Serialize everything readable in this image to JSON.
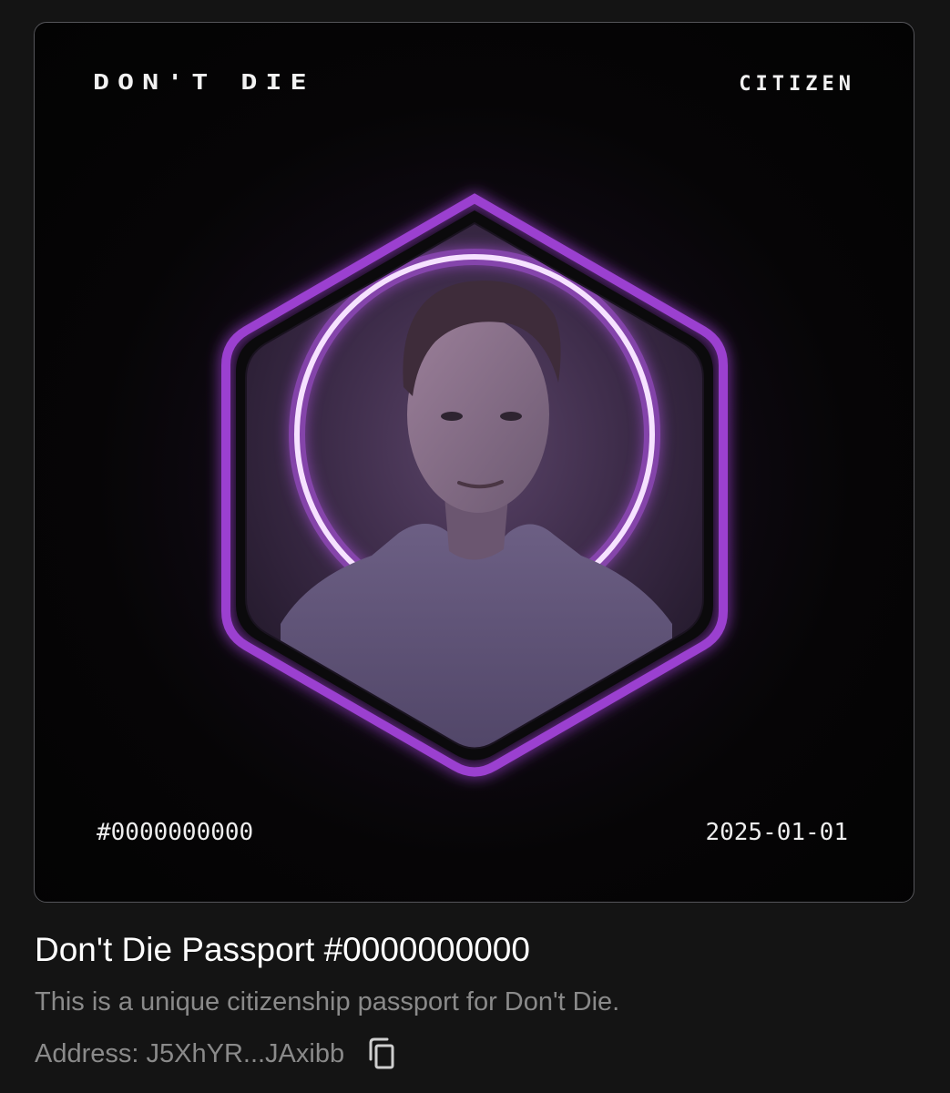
{
  "card": {
    "brand": "DON'T DIE",
    "rank": "CITIZEN",
    "serial": "#0000000000",
    "date": "2025-01-01",
    "portrait_alt": "Portrait of a man in a purple hoodie inside a glowing hexagon"
  },
  "info": {
    "title": "Don't Die Passport #0000000000",
    "description": "This is a unique citizenship passport for Don't Die.",
    "address": "Address: J5XhYR...JAxibb"
  },
  "icons": {
    "copy": "copy-icon"
  },
  "colors": {
    "background": "#141414",
    "accent_purple": "#9b3fd0",
    "ring_glow": "#e9b4ff",
    "muted_text": "#8a8a8a"
  }
}
